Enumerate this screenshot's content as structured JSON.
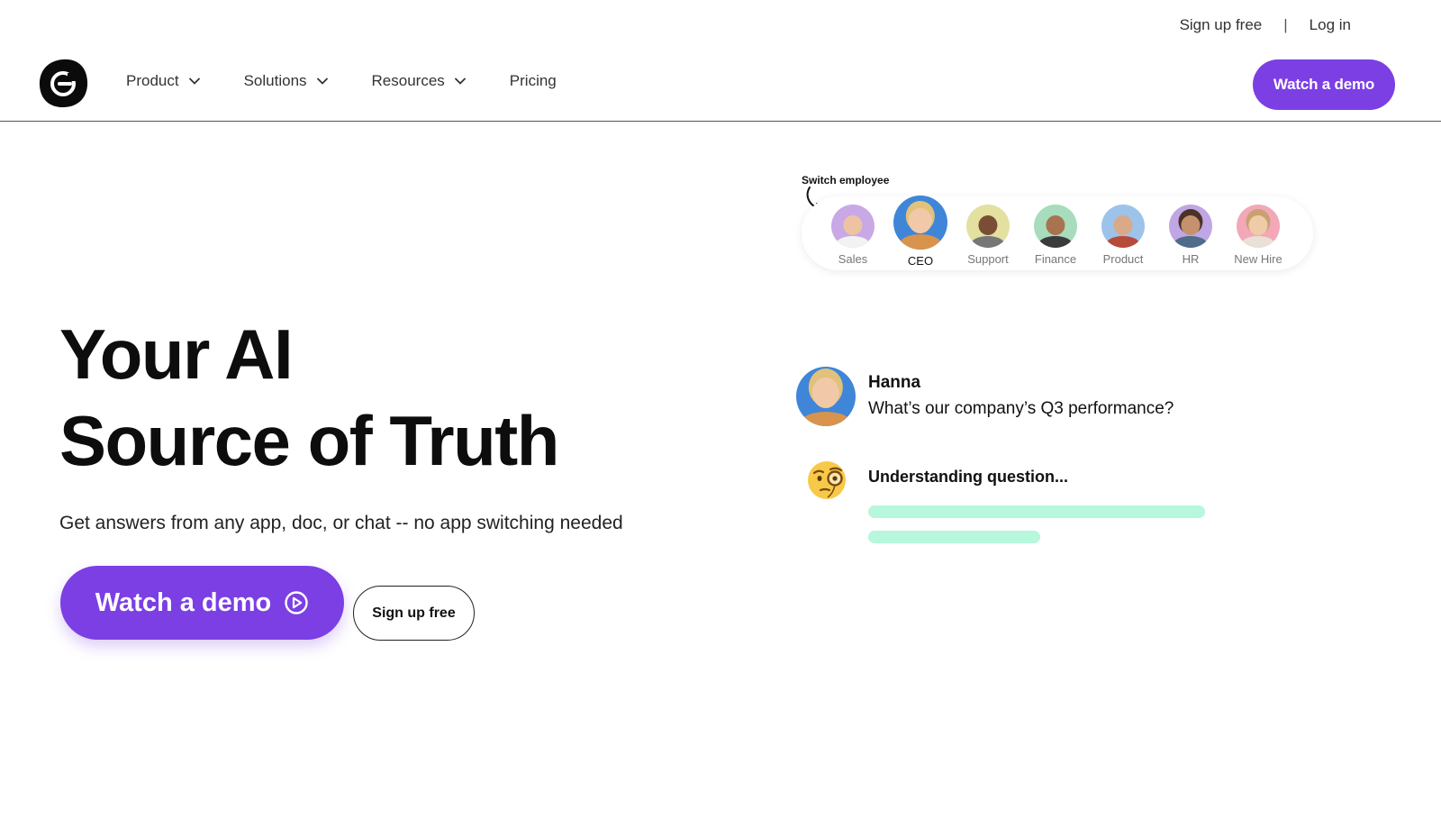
{
  "utility": {
    "signup": "Sign up free",
    "separator": "|",
    "login": "Log in"
  },
  "header": {
    "logo_icon": "brand-logo-icon",
    "nav": [
      {
        "label": "Product",
        "has_dropdown": true
      },
      {
        "label": "Solutions",
        "has_dropdown": true
      },
      {
        "label": "Resources",
        "has_dropdown": true
      },
      {
        "label": "Pricing",
        "has_dropdown": false
      }
    ],
    "cta": "Watch a demo"
  },
  "hero": {
    "title_line1": "Your AI",
    "title_line2": "Source of Truth",
    "subtitle": "Get answers from any app, doc, or chat -- no app switching needed",
    "primary_cta": "Watch a demo",
    "primary_cta_icon": "play-circle-icon",
    "secondary_cta": "Sign up free"
  },
  "switcher": {
    "label": "Switch employee",
    "employees": [
      {
        "label": "Sales",
        "active": false
      },
      {
        "label": "CEO",
        "active": true
      },
      {
        "label": "Support",
        "active": false
      },
      {
        "label": "Finance",
        "active": false
      },
      {
        "label": "Product",
        "active": false
      },
      {
        "label": "HR",
        "active": false
      },
      {
        "label": "New Hire",
        "active": false
      }
    ]
  },
  "chat": {
    "user_name": "Hanna",
    "question": "What’s our company’s Q3 performance?",
    "status_icon": "monocle-face-icon",
    "status": "Understanding question..."
  },
  "colors": {
    "accent": "#7b3fe4",
    "progress": "#b7f7dc"
  }
}
